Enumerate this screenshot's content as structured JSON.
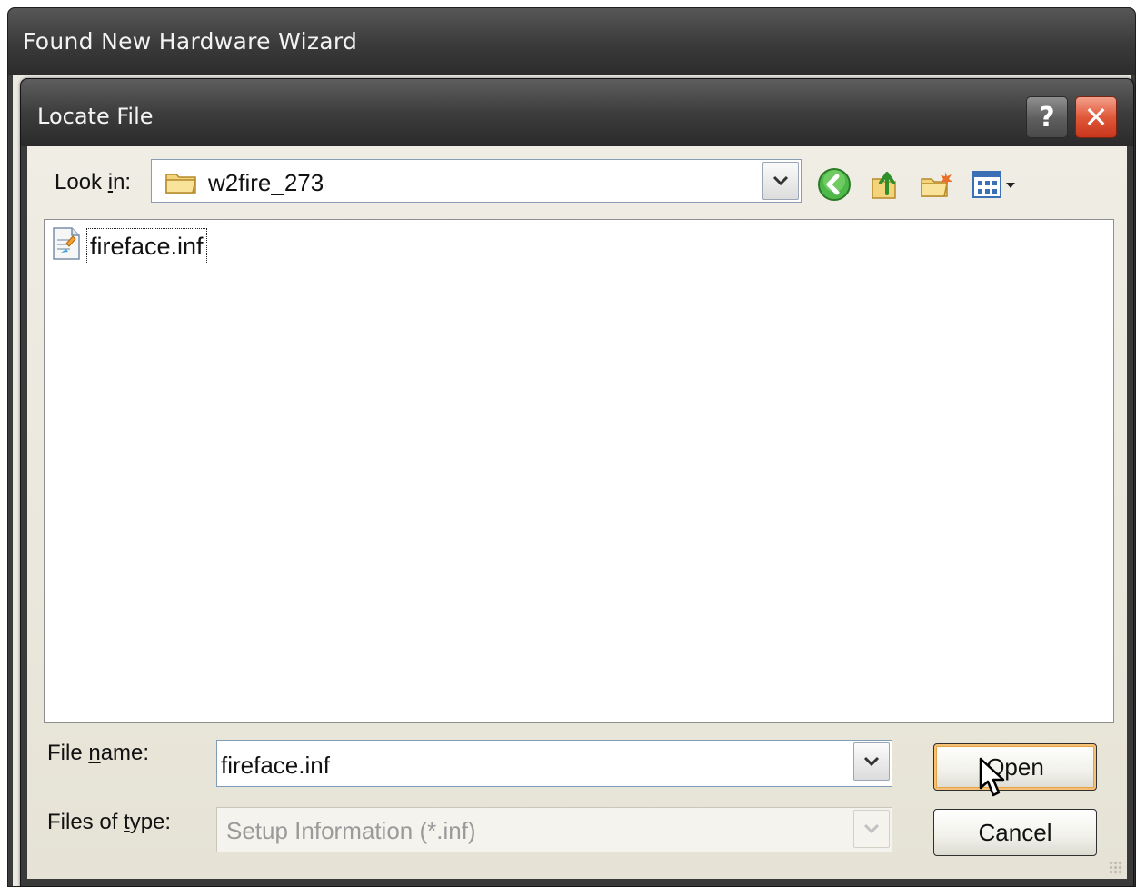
{
  "outer_window": {
    "title": "Found New Hardware Wizard"
  },
  "dialog": {
    "title": "Locate File",
    "help_label": "?",
    "close_label": "✕",
    "look_in": {
      "label_prefix": "Look ",
      "label_accel": "i",
      "label_suffix": "n:",
      "value": "w2fire_273"
    },
    "toolbar_icons": [
      "back-icon",
      "up-folder-icon",
      "new-folder-icon",
      "view-menu-icon"
    ],
    "files": [
      {
        "name": "fireface.inf",
        "icon": "setup-information-file-icon"
      }
    ],
    "file_name": {
      "label_prefix": "File ",
      "label_accel": "n",
      "label_suffix": "ame:",
      "value": "fireface.inf"
    },
    "files_of_type": {
      "label_prefix": "Files of ",
      "label_accel": "t",
      "label_suffix": "ype:",
      "value": "Setup Information (*.inf)"
    },
    "open_label": "Open",
    "cancel_label": "Cancel"
  },
  "colors": {
    "titlebar": "#3c3c3c",
    "close_button": "#e0583a",
    "dialog_face": "#ece9d8",
    "open_focus": "#e7a24a"
  }
}
